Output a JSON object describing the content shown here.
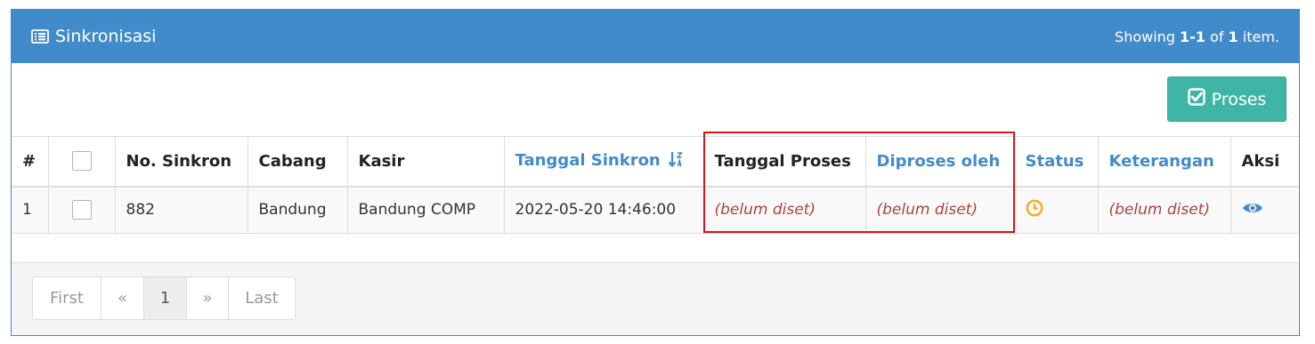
{
  "panel": {
    "title": "Sinkronisasi",
    "summary_prefix": "Showing ",
    "summary_range": "1-1",
    "summary_of": " of ",
    "summary_total": "1",
    "summary_suffix": " item."
  },
  "toolbar": {
    "proses_label": "Proses"
  },
  "table": {
    "headers": {
      "num": "#",
      "no_sinkron": "No. Sinkron",
      "cabang": "Cabang",
      "kasir": "Kasir",
      "tanggal_sinkron": "Tanggal Sinkron",
      "tanggal_proses": "Tanggal Proses",
      "diproses_oleh": "Diproses oleh",
      "status": "Status",
      "keterangan": "Keterangan",
      "aksi": "Aksi"
    },
    "rows": [
      {
        "num": "1",
        "no_sinkron": "882",
        "cabang": "Bandung",
        "kasir": "Bandung COMP",
        "tanggal_sinkron": "2022-05-20 14:46:00",
        "tanggal_proses": "(belum diset)",
        "diproses_oleh": "(belum diset)",
        "status_icon": "clock-icon",
        "keterangan": "(belum diset)",
        "aksi_icon": "eye-icon"
      }
    ]
  },
  "pagination": {
    "first": "First",
    "prev": "«",
    "page": "1",
    "next": "»",
    "last": "Last"
  },
  "colors": {
    "header_bg": "#428bca",
    "button_bg": "#3fb5a6",
    "unset_text": "#a94442",
    "status_clock": "#f0ad1c",
    "highlight_border": "#d9141a"
  }
}
